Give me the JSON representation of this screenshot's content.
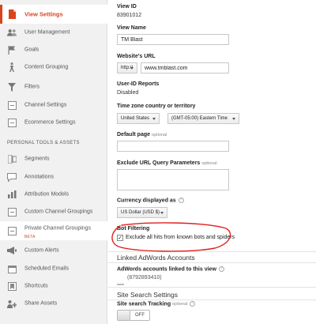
{
  "colors": {
    "accent": "#d9441c",
    "annotation_red": "#e0201c",
    "sidebar_bg": "#f1f1f1"
  },
  "sidebar": {
    "items": [
      {
        "label": "View Settings",
        "icon": "document-icon",
        "active": true
      },
      {
        "label": "User Management",
        "icon": "users-icon"
      },
      {
        "label": "Goals",
        "icon": "flag-icon"
      },
      {
        "label": "Content Grouping",
        "icon": "person-run-icon"
      },
      {
        "label": "Filters",
        "icon": "funnel-icon"
      },
      {
        "label": "Channel Settings",
        "icon": "grid-box-icon"
      },
      {
        "label": "Ecommerce Settings",
        "icon": "cart-icon"
      }
    ],
    "personal_header": "PERSONAL TOOLS & ASSETS",
    "personal_items": [
      {
        "label": "Segments",
        "icon": "segments-icon"
      },
      {
        "label": "Annotations",
        "icon": "chat-bubble-icon"
      },
      {
        "label": "Attribution Models",
        "icon": "bar-chart-icon"
      },
      {
        "label": "Custom Channel Groupings",
        "icon": "grid-box-icon"
      },
      {
        "label": "Private Channel Groupings",
        "badge": "BETA",
        "icon": "grid-box-icon"
      },
      {
        "label": "Custom Alerts",
        "icon": "megaphone-icon"
      },
      {
        "label": "Scheduled Emails",
        "icon": "calendar-icon"
      },
      {
        "label": "Shortcuts",
        "icon": "bookmark-icon"
      },
      {
        "label": "Share Assets",
        "icon": "share-icon"
      }
    ]
  },
  "view": {
    "view_id_label": "View ID",
    "view_id": "83901012",
    "view_name_label": "View Name",
    "view_name": "TM Blast",
    "website_url_label": "Website's URL",
    "url_protocol": "http://",
    "url_value": "www.tmblast.com",
    "userid_label": "User-ID Reports",
    "userid_value": "Disabled",
    "timezone_label": "Time zone country or territory",
    "timezone_country": "United States",
    "timezone_zone": "(GMT-05:00) Eastern Time",
    "default_page_label": "Default page",
    "default_page_optional": "optional",
    "default_page_value": "",
    "exclude_label": "Exclude URL Query Parameters",
    "exclude_optional": "optional",
    "exclude_value": "",
    "currency_label": "Currency displayed as",
    "currency_help": "?",
    "currency_value": "US Dollar (USD $)",
    "bot_filter_label": "Bot Filtering",
    "bot_filter_checked": true,
    "bot_filter_check_glyph": "✓",
    "bot_filter_text": "Exclude all hits from known bots and spiders"
  },
  "adwords": {
    "section_title": "Linked AdWords Accounts",
    "linked_label": "AdWords accounts linked to this view",
    "help": "?",
    "account": "(8792893410)"
  },
  "site_search": {
    "section_title": "Site Search Settings",
    "tracking_label": "Site search Tracking",
    "tracking_optional": "optional",
    "help": "?",
    "toggle_state": "OFF"
  }
}
